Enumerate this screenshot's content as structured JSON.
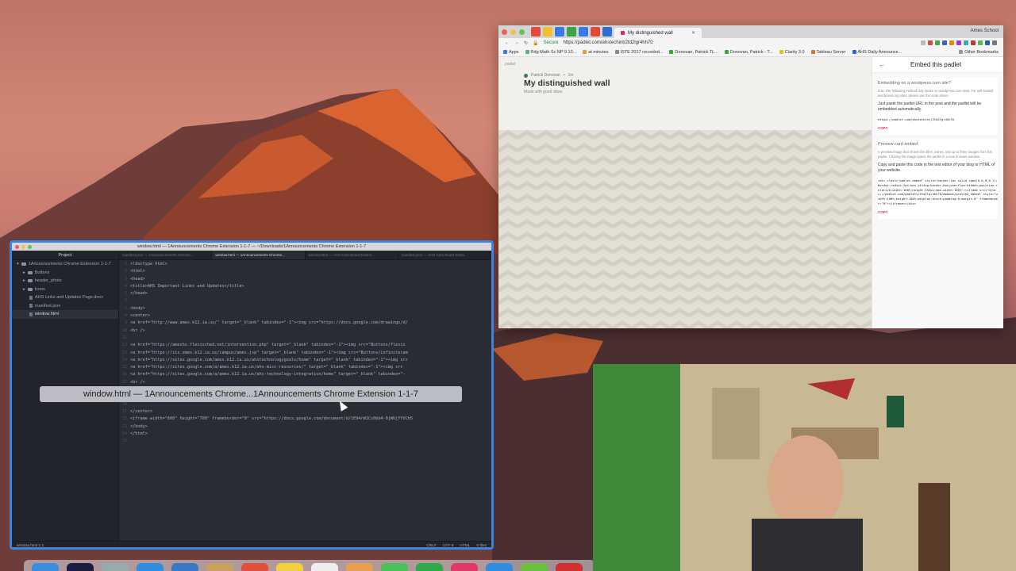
{
  "browser": {
    "tab_title": "My distinguished wall",
    "profile": "Ames School",
    "secure_label": "Secure",
    "url": "https://padlet.com/ahstechint/2td2lgr4hh70",
    "bookmarks": [
      "Apps",
      "Rdg Math Sc NP 9.10...",
      "at minutes",
      "ISTE 2017 recorded...",
      "Donovan, Patrick TL...",
      "Donovan, Patrick - T...",
      "Clarity 3.0",
      "Tableau Server",
      "AHS Daily Announce..."
    ],
    "other_bookmarks": "Other Bookmarks",
    "accent_green": "#1a8a3a"
  },
  "padlet": {
    "logo": "padlet",
    "author": "Patrick Donovan",
    "age": "1m",
    "title": "My distinguished wall",
    "subtitle": "Made with good vibes"
  },
  "embed": {
    "title": "Embed this padlet",
    "wp_heading": "Embedding on a wordpress.com site?",
    "wp_note": "N.B. The following method only works on wordpress.com sites. For self-hosted wordpress.org sites, please use the code above.",
    "wp_instruction": "Just paste the padlet URL in the post and the padlet will be embedded automatically.",
    "wp_url": "https://padlet.com/ahstechint/2td2lgr4hh70",
    "copy_label": "COPY",
    "card_heading": "Preview card embed",
    "card_note": "A preview image that shows the titles, owner, and up to three images from the padlet. Clicking the image opens the padlet in a new browser window.",
    "card_instruction": "Copy and paste this code in the text editor of your blog or HTML of your website.",
    "card_code": "<div class=\"padlet-embed\" style=\"border:1px solid rgba(0,0,0,0.1);border-radius:2px;box-sizing:border-box;overflow:hidden;position:relative;width:100%;height:152px;max-width:100%\"><iframe src=\"https://padlet.com/padlets/2td2lgr4hh70/embeds/preview_embed\" style=\"width:100%;height:100%;display:block;padding:0;margin:0\" frameborder=\"0\"></iframe></div>",
    "accent_pink": "#d62f67"
  },
  "atom": {
    "window_title": "window.html — 1Announcements Chrome Extension 1-1-7 — ~/Downloads/1Announcements Chrome Extension 1-1-7",
    "project_label": "Project",
    "tree": [
      {
        "label": "1Announcements Chrome Extension 1-1-7",
        "kind": "folder"
      },
      {
        "label": "Buttons",
        "kind": "folder"
      },
      {
        "label": "header_photo",
        "kind": "folder"
      },
      {
        "label": "Icons",
        "kind": "folder"
      },
      {
        "label": "AHS Links and Updates Page.docx",
        "kind": "file"
      },
      {
        "label": "manifest.json",
        "kind": "file"
      },
      {
        "label": "window.html",
        "kind": "file"
      }
    ],
    "tabs": [
      "manifest.json — 1Announcements Chrome...",
      "window.html — 1Announcements Chrome...",
      "window.html — AHS Cork Board Extens...",
      "manifest.json — AHS Cork Board Exten..."
    ],
    "code": [
      "<!doctype html>",
      "<html>",
      "<head>",
      "    <title>AHS Important Links and Updates</title>",
      "</head>",
      "",
      "<body>",
      "    <center>",
      "        <a href=\"http://www.ames.k12.ia.us/\" target=\"_blank\" tabindex=\"-1\"><img src=\"https://docs.google.com/drawings/d/",
      "        <br />",
      "",
      "            <a href=\"https://ameshs.flexisched.net/intervention.php\" target=\"_blank\" tabindex=\"-1\"><img src=\"Buttons/flexis",
      "            <a href=\"https://sis.ames.k12.ia.us/campus/ames.jsp\" target=\"_blank\" tabindex=\"-1\"><img src=\"Buttons/infinitecam",
      "            <a href=\"https://sites.google.com/ames.k12.ia.us/ahstechnologygoals/home\" target=\"_blank\" tabindex=\"-1\"><img src",
      "            <a href=\"https://sites.google.com/a/ames.k12.ia.us/ahs-misc-resources/\" target=\"_blank\" tabindex=\"-1\"><img src",
      "            <a href=\"https://sites.google.com/a/ames.k12.ia.us/ahs-technology-integration/home\" target=\"_blank\" tabindex=\"-",
      "            <br />",
      "            <a href=\"https://sites.google.com/a/ames.k12.ia.us/teacher-leaders/home\" target=\"_blank\" tabindex=\"-1\"><img src",
      "",
      "",
      "    </center>",
      "    <iframe width=\"600\" height=\"700\" frameborder=\"0\" src=\"https://docs.google.com/document/d/1E94rW1Cu9bb4-0jWUjYYVCb5",
      "</body>",
      "</html>",
      ""
    ],
    "status_left": "window.html  1:1",
    "status_right": [
      "CRLF",
      "UTF-8",
      "HTML",
      "0 files"
    ],
    "accent_blue": "#3d83e0"
  },
  "tooltip": "window.html — 1Announcements Chrome...1Announcements Chrome Extension 1-1-7"
}
